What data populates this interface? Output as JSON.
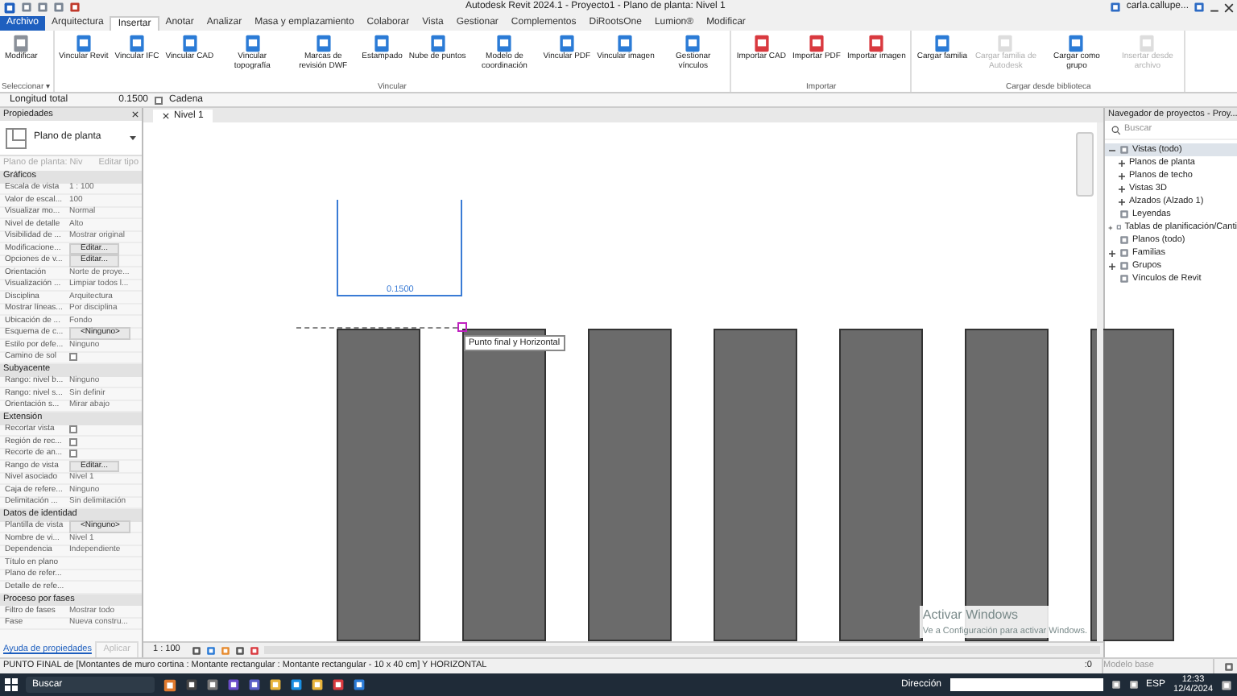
{
  "window": {
    "title": "Autodesk Revit 2024.1 - Proyecto1 - Plano de planta: Nivel 1",
    "user": "carla.callupe..."
  },
  "file_menu": "Archivo",
  "tabs": [
    {
      "label": "Arquitectura",
      "selected": false
    },
    {
      "label": "Insertar",
      "selected": true
    },
    {
      "label": "Anotar",
      "selected": false
    },
    {
      "label": "Analizar",
      "selected": false
    },
    {
      "label": "Masa y emplazamiento",
      "selected": false
    },
    {
      "label": "Colaborar",
      "selected": false
    },
    {
      "label": "Vista",
      "selected": false
    },
    {
      "label": "Gestionar",
      "selected": false
    },
    {
      "label": "Complementos",
      "selected": false
    },
    {
      "label": "DiRootsOne",
      "selected": false
    },
    {
      "label": "Lumion®",
      "selected": false
    },
    {
      "label": "Modificar",
      "selected": false
    }
  ],
  "ribbon": [
    {
      "label": "Seleccionar ▾",
      "buttons": [
        {
          "label": "Modificar",
          "disabled": false
        }
      ]
    },
    {
      "label": "Vincular",
      "buttons": [
        {
          "label": "Vincular Revit",
          "disabled": false
        },
        {
          "label": "Vincular IFC",
          "disabled": false
        },
        {
          "label": "Vincular CAD",
          "disabled": false
        },
        {
          "label": "Vincular topografía",
          "disabled": false
        },
        {
          "label": "Marcas de revisión DWF",
          "disabled": false
        },
        {
          "label": "Estampado",
          "disabled": false
        },
        {
          "label": "Nube de puntos",
          "disabled": false
        },
        {
          "label": "Modelo de coordinación",
          "disabled": false
        },
        {
          "label": "Vincular PDF",
          "disabled": false
        },
        {
          "label": "Vincular imagen",
          "disabled": false
        },
        {
          "label": "Gestionar vínculos",
          "disabled": false
        }
      ]
    },
    {
      "label": "Importar",
      "buttons": [
        {
          "label": "Importar CAD",
          "disabled": false
        },
        {
          "label": "Importar PDF",
          "disabled": false
        },
        {
          "label": "Importar imagen",
          "disabled": false
        }
      ]
    },
    {
      "label": "Cargar desde biblioteca",
      "buttons": [
        {
          "label": "Cargar familia",
          "disabled": false
        },
        {
          "label": "Cargar familia de Autodesk",
          "disabled": true
        },
        {
          "label": "Cargar como grupo",
          "disabled": false
        },
        {
          "label": "Insertar desde archivo",
          "disabled": true
        }
      ]
    }
  ],
  "options_bar": {
    "label": "Longitud total",
    "value": "0.1500",
    "chain": {
      "label": "Cadena",
      "checked": false
    }
  },
  "properties": {
    "title": "Propiedades",
    "type": "Plano de planta",
    "instance": "Plano de planta: Niv",
    "edit_type": "Editar tipo",
    "groups": [
      {
        "name": "Gráficos",
        "rows": [
          {
            "label": "Escala de vista",
            "kind": "text",
            "value": "1 : 100"
          },
          {
            "label": "Valor de escal...",
            "kind": "text",
            "value": "100"
          },
          {
            "label": "Visualizar mo...",
            "kind": "text",
            "value": "Normal"
          },
          {
            "label": "Nivel de detalle",
            "kind": "text",
            "value": "Alto"
          },
          {
            "label": "Visibilidad de ...",
            "kind": "text",
            "value": "Mostrar original"
          },
          {
            "label": "Modificacione...",
            "kind": "button",
            "value": "Editar..."
          },
          {
            "label": "Opciones de v...",
            "kind": "button",
            "value": "Editar..."
          },
          {
            "label": "Orientación",
            "kind": "text",
            "value": "Norte de proye..."
          },
          {
            "label": "Visualización ...",
            "kind": "text",
            "value": "Limpiar todos l..."
          },
          {
            "label": "Disciplina",
            "kind": "text",
            "value": "Arquitectura"
          },
          {
            "label": "Mostrar líneas...",
            "kind": "text",
            "value": "Por disciplina"
          },
          {
            "label": "Ubicación de ...",
            "kind": "text",
            "value": "Fondo"
          },
          {
            "label": "Esquema de c...",
            "kind": "button",
            "value": "<Ninguno>"
          },
          {
            "label": "Estilo por defe...",
            "kind": "text",
            "value": "Ninguno"
          },
          {
            "label": "Camino de sol",
            "kind": "checkbox",
            "checked": false
          }
        ]
      },
      {
        "name": "Subyacente",
        "rows": [
          {
            "label": "Rango: nivel b...",
            "kind": "text",
            "value": "Ninguno"
          },
          {
            "label": "Rango: nivel s...",
            "kind": "text",
            "value": "Sin definir"
          },
          {
            "label": "Orientación s...",
            "kind": "text",
            "value": "Mirar abajo"
          }
        ]
      },
      {
        "name": "Extensión",
        "rows": [
          {
            "label": "Recortar vista",
            "kind": "checkbox",
            "checked": false
          },
          {
            "label": "Región de rec...",
            "kind": "checkbox",
            "checked": false
          },
          {
            "label": "Recorte de an...",
            "kind": "checkbox",
            "checked": false
          },
          {
            "label": "Rango de vista",
            "kind": "button",
            "value": "Editar..."
          },
          {
            "label": "Nivel asociado",
            "kind": "text",
            "value": "Nivel 1"
          },
          {
            "label": "Caja de refere...",
            "kind": "text",
            "value": "Ninguno"
          },
          {
            "label": "Delimitación ...",
            "kind": "text",
            "value": "Sin delimitación"
          }
        ]
      },
      {
        "name": "Datos de identidad",
        "rows": [
          {
            "label": "Plantilla de vista",
            "kind": "button",
            "value": "<Ninguno>"
          },
          {
            "label": "Nombre de vi...",
            "kind": "text",
            "value": "Nivel 1"
          },
          {
            "label": "Dependencia",
            "kind": "text",
            "value": "Independiente"
          },
          {
            "label": "Título en plano",
            "kind": "text",
            "value": ""
          },
          {
            "label": "Plano de refer...",
            "kind": "text",
            "value": ""
          },
          {
            "label": "Detalle de refe...",
            "kind": "text",
            "value": ""
          }
        ]
      },
      {
        "name": "Proceso por fases",
        "rows": [
          {
            "label": "Filtro de fases",
            "kind": "text",
            "value": "Mostrar todo"
          },
          {
            "label": "Fase",
            "kind": "text",
            "value": "Nueva constru..."
          }
        ]
      }
    ],
    "help_link": "Ayuda de propiedades",
    "apply": {
      "label": "Aplicar",
      "disabled": true
    }
  },
  "view": {
    "tab": "Nivel 1",
    "dimension": "0.1500",
    "tooltip": "Punto final y Horizontal",
    "scale": "1 : 100"
  },
  "browser": {
    "title": "Navegador de proyectos - Proy...",
    "search": {
      "placeholder": "Buscar"
    },
    "items": [
      {
        "label": "Vistas (todo)",
        "expanded": true,
        "selected": true,
        "children": [
          {
            "label": "Planos de planta",
            "expanded": false,
            "selected": false
          },
          {
            "label": "Planos de techo",
            "expanded": false,
            "selected": false
          },
          {
            "label": "Vistas 3D",
            "expanded": false,
            "selected": false
          },
          {
            "label": "Alzados (Alzado 1)",
            "expanded": false,
            "selected": false
          }
        ]
      },
      {
        "label": "Leyendas",
        "selected": false
      },
      {
        "label": "Tablas de planificación/Canti",
        "expanded": false,
        "selected": false
      },
      {
        "label": "Planos (todo)",
        "selected": false
      },
      {
        "label": "Familias",
        "expanded": false,
        "selected": false
      },
      {
        "label": "Grupos",
        "expanded": false,
        "selected": false
      },
      {
        "label": "Vínculos de Revit",
        "selected": false
      }
    ]
  },
  "activation": {
    "title": "Activar Windows",
    "text": "Ve a Configuración para activar Windows."
  },
  "status_bar": {
    "text": "PUNTO FINAL de [Montantes de muro cortina : Montante rectangular : Montante rectangular - 10 x 40 cm] Y HORIZONTAL",
    "count": ":0",
    "model": "Modelo base"
  },
  "taskbar": {
    "search": "Buscar",
    "address": "Dirección",
    "language": "ESP",
    "time": "12:33",
    "date": "12/4/2024"
  }
}
